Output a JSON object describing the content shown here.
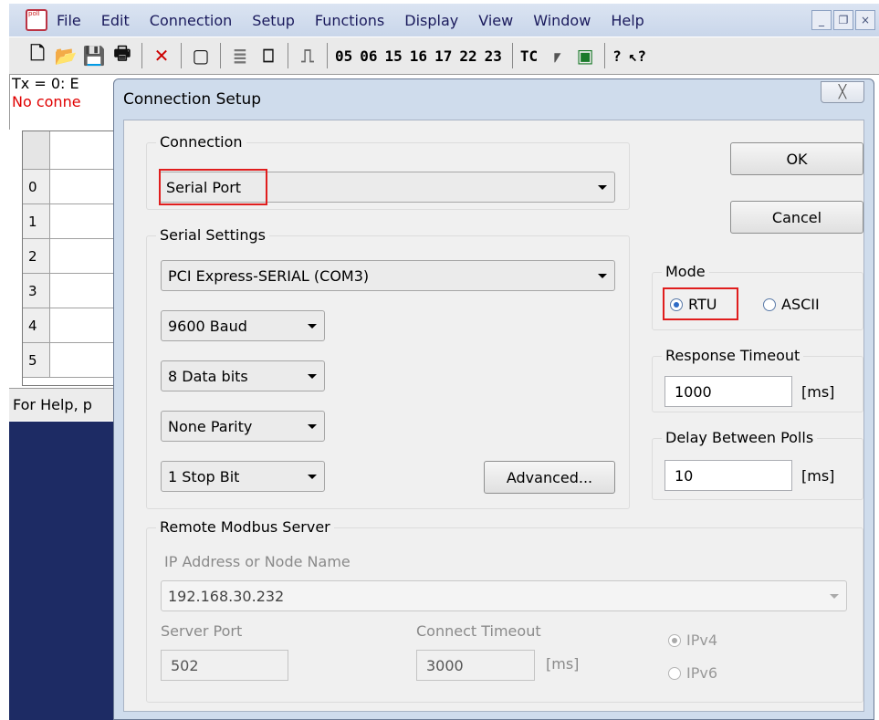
{
  "app": {
    "menu": [
      "File",
      "Edit",
      "Connection",
      "Setup",
      "Functions",
      "Display",
      "View",
      "Window",
      "Help"
    ],
    "window_controls": [
      "_",
      "Ɖ",
      "×"
    ],
    "toolbar": {
      "function_codes": [
        "05",
        "06",
        "15",
        "16",
        "17",
        "22",
        "23"
      ],
      "tc_label": "TC",
      "help_glyph": "?",
      "whatsthis_glyph": "↖?"
    },
    "status": {
      "tx": "Tx = 0: E",
      "no_connection": "No conne"
    },
    "grid_rows": [
      "0",
      "1",
      "2",
      "3",
      "4",
      "5"
    ],
    "help_text": "For Help, p"
  },
  "dialog": {
    "title": "Connection Setup",
    "close_glyph": "╳",
    "connection": {
      "group_label": "Connection",
      "value": "Serial Port"
    },
    "serial_settings": {
      "group_label": "Serial Settings",
      "port": "PCI Express-SERIAL (COM3)",
      "baud": "9600 Baud",
      "data_bits": "8 Data bits",
      "parity": "None Parity",
      "stop_bits": "1 Stop Bit",
      "advanced_label": "Advanced..."
    },
    "ok_label": "OK",
    "cancel_label": "Cancel",
    "mode": {
      "group_label": "Mode",
      "rtu_label": "RTU",
      "ascii_label": "ASCII",
      "selected": "RTU"
    },
    "response_timeout": {
      "group_label": "Response Timeout",
      "value": "1000",
      "unit": "[ms]"
    },
    "delay_between_polls": {
      "group_label": "Delay Between Polls",
      "value": "10",
      "unit": "[ms]"
    },
    "remote_server": {
      "group_label": "Remote Modbus Server",
      "ip_label": "IP Address or Node Name",
      "ip_value": "192.168.30.232",
      "port_label": "Server Port",
      "port_value": "502",
      "connect_timeout_label": "Connect Timeout",
      "connect_timeout_value": "3000",
      "connect_timeout_unit": "[ms]",
      "ipv4_label": "IPv4",
      "ipv6_label": "IPv6",
      "selected_ip_version": "IPv4"
    }
  },
  "colors": {
    "highlight": "#e01d1d",
    "no_connection_text": "#e00000",
    "dialog_frame": "#cfdcec",
    "desktop": "#1d2b64"
  }
}
